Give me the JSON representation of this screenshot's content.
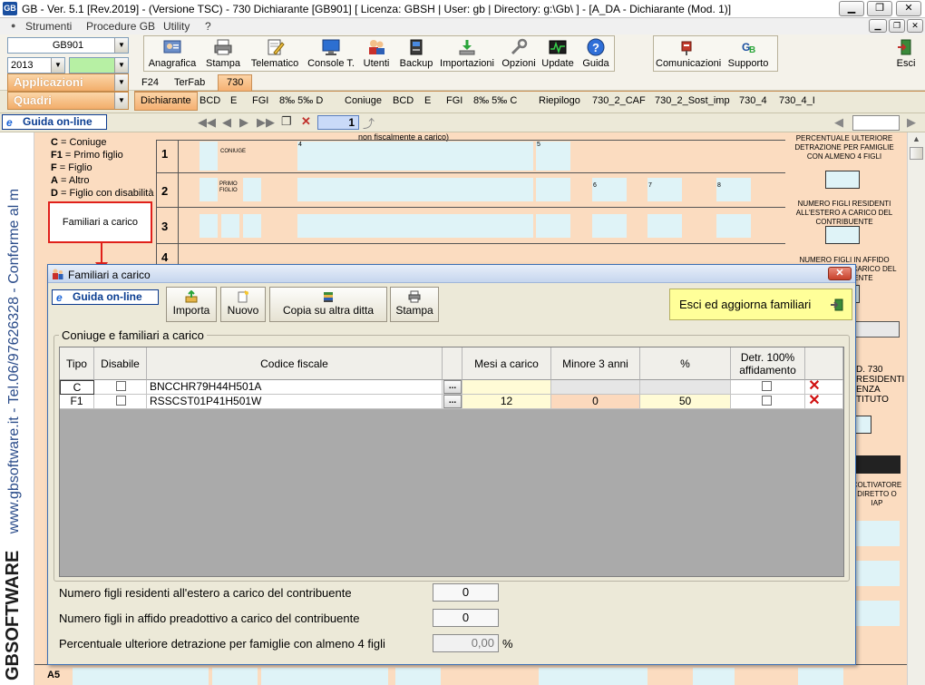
{
  "window": {
    "title": "GB - Ver. 5.1 [Rev.2019] - (Versione TSC) - 730 Dichiarante [GB901]    [ Licenza: GBSH | User: gb | Directory: g:\\Gb\\ ] - [A_DA - Dichiarante (Mod. 1)]",
    "logo": "GB",
    "min": "▁",
    "restore": "❐",
    "close": "✕"
  },
  "menu": {
    "items": [
      "Strumenti",
      "Procedure GB",
      "Utility",
      "?"
    ]
  },
  "toolbar": {
    "company_code": "GB901",
    "year": "2013",
    "applicazioni": "Applicazioni",
    "quadri": "Quadri",
    "buttons": [
      {
        "label": "Anagrafica",
        "icon": "person-card-icon"
      },
      {
        "label": "Stampa",
        "icon": "printer-icon"
      },
      {
        "label": "Telematico",
        "icon": "document-pencil-icon"
      },
      {
        "label": "Console T.",
        "icon": "monitor-icon"
      },
      {
        "label": "Utenti",
        "icon": "users-icon"
      },
      {
        "label": "Backup",
        "icon": "backup-icon"
      },
      {
        "label": "Importazioni",
        "icon": "import-icon"
      },
      {
        "label": "Opzioni",
        "icon": "wrench-icon"
      },
      {
        "label": "Update",
        "icon": "update-icon"
      },
      {
        "label": "Guida",
        "icon": "help-icon"
      }
    ],
    "comunicazioni": "Comunicazioni",
    "supporto": "Supporto",
    "esci": "Esci"
  },
  "tabs_top": [
    "F24",
    "TerFab",
    "730"
  ],
  "tabs_bottom": [
    "Dichiarante",
    "BCD",
    "E",
    "FGI",
    "8‰ 5‰ D",
    "Coniuge",
    "BCD",
    "E",
    "FGI",
    "8‰ 5‰ C",
    "Riepilogo",
    "730_2_CAF",
    "730_2_Sost_imp",
    "730_4",
    "730_4_I"
  ],
  "nav": {
    "guida": "Guida on-line",
    "page": "1"
  },
  "side_text": {
    "brand": "GBSOFTWARE",
    "contact": "www.gbsoftware.it - Tel.06/97626328 - Conforme al m"
  },
  "form": {
    "legend": [
      {
        "code": "C",
        "text": "= Coniuge"
      },
      {
        "code": "F1",
        "text": "= Primo figlio"
      },
      {
        "code": "F",
        "text": "= Figlio"
      },
      {
        "code": "A",
        "text": "= Altro"
      },
      {
        "code": "D",
        "text": "= Figlio con disabilità"
      }
    ],
    "familiari_button": "Familiari a carico",
    "header_fragment": "non fiscalmente a carico)",
    "rows": [
      "1",
      "2",
      "3",
      "4"
    ],
    "coniuge": "CONIUGE",
    "primo_figlio": "PRIMO FIGLIO",
    "col_numbers": [
      "4",
      "5",
      "6",
      "7",
      "8"
    ],
    "right_panel": {
      "perc_text": "PERCENTUALE ULTERIORE DETRAZIONE PER FAMIGLIE CON ALMENO 4 FIGLI",
      "numero_estero": "NUMERO FIGLI RESIDENTI ALL'ESTERO A CARICO DEL CONTRIBUENTE",
      "numero_affido": "NUMERO FIGLI IN AFFIDO PREADOTTIVO A CARICO DEL CONTRIBUENTE",
      "partial_730": "D. 730",
      "partial_residenti": "RESIDENTI",
      "partial_enza": "ENZA",
      "partial_tituto": "TITUTO",
      "coltivatore": "COLTIVATORE DIRETTO O IAP"
    },
    "a5": "A5"
  },
  "dialog": {
    "title": "Familiari a carico",
    "close": "✕",
    "guida": "Guida on-line",
    "buttons": [
      {
        "label": "Importa",
        "icon": "import-arrow-icon"
      },
      {
        "label": "Nuovo",
        "icon": "new-document-icon"
      },
      {
        "label": "Copia su altra ditta",
        "icon": "copy-books-icon"
      },
      {
        "label": "Stampa",
        "icon": "printer-icon"
      }
    ],
    "exit_button": "Esci ed aggiorna familiari",
    "group_label": "Coniuge e familiari a carico",
    "columns": [
      "Tipo",
      "Disabile",
      "Codice fiscale",
      "Mesi a carico",
      "Minore 3 anni",
      "%",
      "Detr. 100% affidamento"
    ],
    "rows": [
      {
        "tipo": "C",
        "disabile": false,
        "codice_fiscale": "BNCCHR79H44H501A",
        "mesi": "",
        "minore": "",
        "perc": "",
        "affidamento": false
      },
      {
        "tipo": "F1",
        "disabile": false,
        "codice_fiscale": "RSSCST01P41H501W",
        "mesi": "12",
        "minore": "0",
        "perc": "50",
        "affidamento": false
      }
    ],
    "ellipsis": "...",
    "delete": "✕",
    "fields": [
      {
        "label": "Numero figli residenti all'estero a carico del contribuente",
        "value": "0"
      },
      {
        "label": "Numero figli in affido preadottivo a carico del contribuente",
        "value": "0"
      },
      {
        "label": "Percentuale ulteriore detrazione per famiglie con almeno 4 figli",
        "value": "0,00",
        "unit": "%"
      }
    ]
  }
}
